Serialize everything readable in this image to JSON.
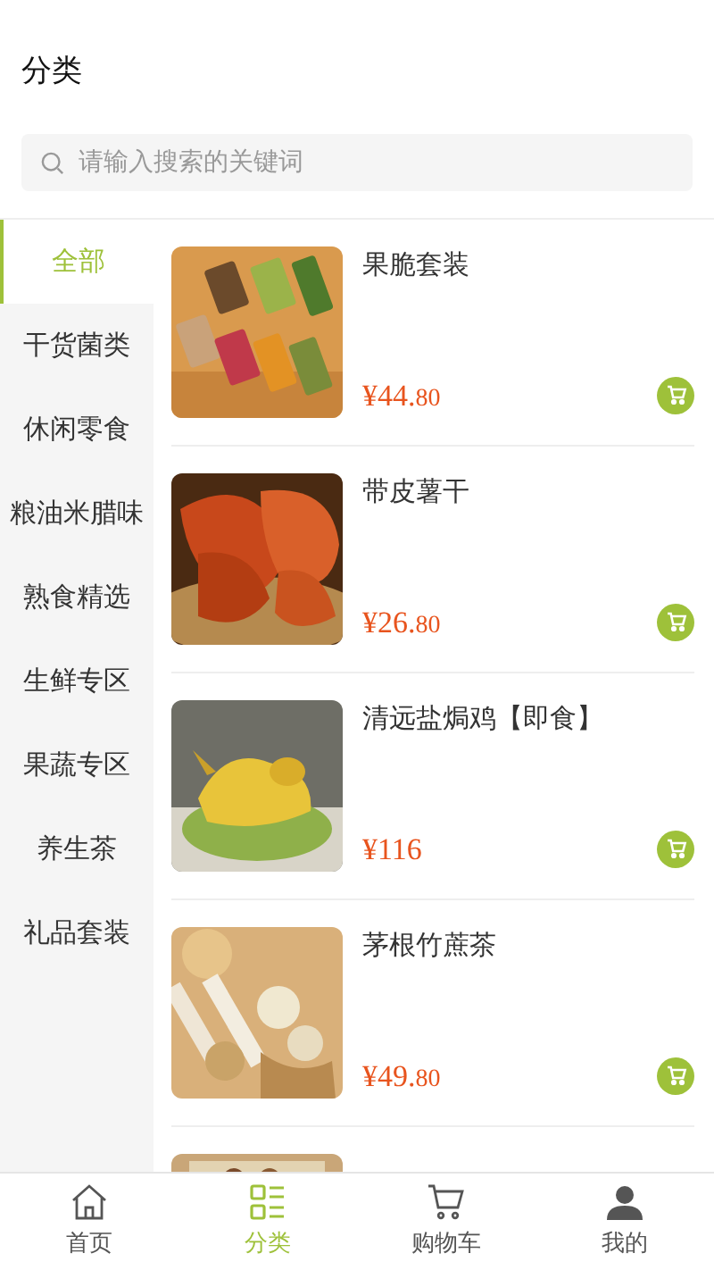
{
  "header": {
    "title": "分类"
  },
  "search": {
    "placeholder": "请输入搜索的关键词"
  },
  "sidebar": {
    "items": [
      {
        "label": "全部",
        "selected": true
      },
      {
        "label": "干货菌类",
        "selected": false
      },
      {
        "label": "休闲零食",
        "selected": false
      },
      {
        "label": "粮油米腊味",
        "selected": false
      },
      {
        "label": "熟食精选",
        "selected": false
      },
      {
        "label": "生鲜专区",
        "selected": false
      },
      {
        "label": "果蔬专区",
        "selected": false
      },
      {
        "label": "养生茶",
        "selected": false
      },
      {
        "label": "礼品套装",
        "selected": false
      }
    ]
  },
  "products": [
    {
      "name": "果脆套装",
      "price": "¥44.",
      "price_cents": "80",
      "kind": "snacks"
    },
    {
      "name": "带皮薯干",
      "price": "¥26.",
      "price_cents": "80",
      "kind": "sweetpotato"
    },
    {
      "name": "清远盐焗鸡【即食】",
      "price": "¥116",
      "kind": "chicken"
    },
    {
      "name": "茅根竹蔗茶",
      "price": "¥49.",
      "price_cents": "80",
      "kind": "tea"
    },
    {
      "kind": "pack"
    }
  ],
  "tab_bar": {
    "items": [
      {
        "label": "首页",
        "kind": "home",
        "selected": false
      },
      {
        "label": "分类",
        "kind": "category",
        "selected": true
      },
      {
        "label": "购物车",
        "kind": "cart",
        "selected": false
      },
      {
        "label": "我的",
        "kind": "user",
        "selected": false
      }
    ]
  }
}
